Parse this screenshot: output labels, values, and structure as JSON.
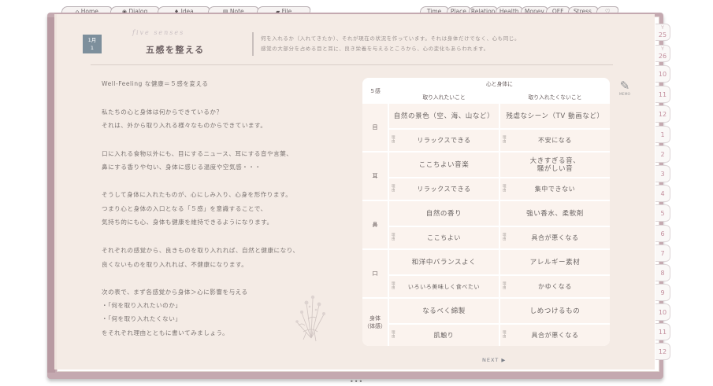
{
  "nav_tabs_left": [
    {
      "icon": "home-icon",
      "glyph": "⌂",
      "label": "Home"
    },
    {
      "icon": "dialog-icon",
      "glyph": "◉",
      "label": "Dialog"
    },
    {
      "icon": "lightbulb-icon",
      "glyph": "♦",
      "label": "Idea"
    },
    {
      "icon": "notebook-icon",
      "glyph": "▤",
      "label": "Note"
    },
    {
      "icon": "folder-icon",
      "glyph": "▰",
      "label": "File"
    }
  ],
  "nav_tabs_right": [
    {
      "label": "Time"
    },
    {
      "label": "Place"
    },
    {
      "label": "Relation"
    },
    {
      "label": "Health"
    },
    {
      "label": "Money"
    },
    {
      "label": "OFF"
    },
    {
      "label": "Stress"
    },
    {
      "label": "♡"
    }
  ],
  "side_tabs": [
    {
      "month": "Y",
      "year": "25"
    },
    {
      "month": "Y",
      "year": "26"
    },
    {
      "month": "10",
      "year": ""
    },
    {
      "month": "11",
      "year": ""
    },
    {
      "month": "12",
      "year": ""
    },
    {
      "month": "1",
      "year": ""
    },
    {
      "month": "2",
      "year": ""
    },
    {
      "month": "3",
      "year": ""
    },
    {
      "month": "4",
      "year": ""
    },
    {
      "month": "5",
      "year": ""
    },
    {
      "month": "6",
      "year": ""
    },
    {
      "month": "7",
      "year": ""
    },
    {
      "month": "8",
      "year": ""
    },
    {
      "month": "9",
      "year": ""
    },
    {
      "month": "10",
      "year": ""
    },
    {
      "month": "11",
      "year": ""
    },
    {
      "month": "12",
      "year": ""
    }
  ],
  "header": {
    "date_month": "1月",
    "date_day": "1",
    "script_title": "five senses",
    "title": "五感を整える",
    "desc_line1": "何を入れるか（入れてきたか）、それが現在の状況を作っています。それは身体だけでなく、心も同じ。",
    "desc_line2": "感覚の大部分を占める目と耳に、良き栄養を与えるところから、心の変化もあらわれます。",
    "memo_label": "MEMO"
  },
  "body": {
    "heading": "Well-Feeling な健康＝５感を変える",
    "lines": [
      "私たちの心と身体は何からできているか？",
      "それは、外から取り入れる様々なものからできています。",
      "口に入れる食物以外にも、目にするニュース、耳にする音や言葉、",
      "鼻にする香りや匂い、身体に感じる温度や空気感・・・",
      "そうして身体に入れたものが、心にしみ入り、心身を形作ります。",
      "つまり心と身体の入口となる「５感」を意識することで、",
      "気持ち的にも心、身体も健康を維持できるようになります。",
      "それぞれの感覚から、良きものを取り入れれば、自然と健康になり、",
      "良くないものを取り入れれば、不健康になります。",
      "次の表で、まず各感覚から身体＞心に影響を与える",
      "・「何を取り入れたいのか」",
      "・「何を取り入れたくない」",
      "をそれぞれ理由とともに書いてみましょう。"
    ]
  },
  "table": {
    "corner": "５感",
    "group_header": "心と身体に",
    "col_want": "取り入れたいこと",
    "col_avoid": "取り入れたくないこと",
    "reason_tag": "理由",
    "rows": [
      {
        "sense": "目",
        "want": "自然の景色（空、海、山など）",
        "want_reason": "リラックスできる",
        "avoid": "残虐なシーン（TV 動画など）",
        "avoid_reason": "不安になる"
      },
      {
        "sense": "耳",
        "want": "ここちよい音楽",
        "want_reason": "リラックスできる",
        "avoid": "大きすぎる音、\n騒がしい音",
        "avoid_reason": "集中できない"
      },
      {
        "sense": "鼻",
        "want": "自然の香り",
        "want_reason": "ここちよい",
        "avoid": "強い香水、柔軟剤",
        "avoid_reason": "具合が悪くなる"
      },
      {
        "sense": "口",
        "want": "和洋中バランスよく",
        "want_reason": "いろいろ美味しく食べたい",
        "avoid": "アレルギー素材",
        "avoid_reason": "かゆくなる"
      },
      {
        "sense": "身体\n（体感）",
        "want": "なるべく綿製",
        "want_reason": "肌触り",
        "avoid": "しめつけるもの",
        "avoid_reason": "具合が悪くなる"
      }
    ]
  },
  "next_label": "NEXT ▶",
  "page_dots": "•••"
}
